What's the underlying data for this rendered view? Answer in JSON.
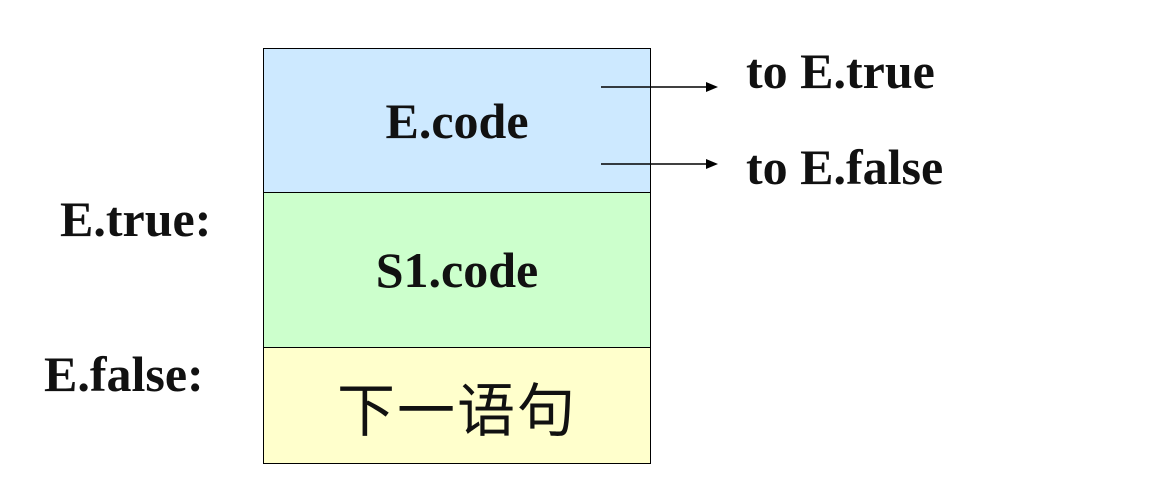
{
  "diagram": {
    "blocks": [
      {
        "label": "E.code",
        "color": "#cde9ff"
      },
      {
        "label": "S1.code",
        "color": "#ccffcc"
      },
      {
        "label": "下一语句",
        "color": "#ffffcc"
      }
    ],
    "side_labels": {
      "e_true": "E.true:",
      "e_false": "E.false:"
    },
    "jump_targets": {
      "to_true": "to E.true",
      "to_false": "to E.false"
    }
  }
}
